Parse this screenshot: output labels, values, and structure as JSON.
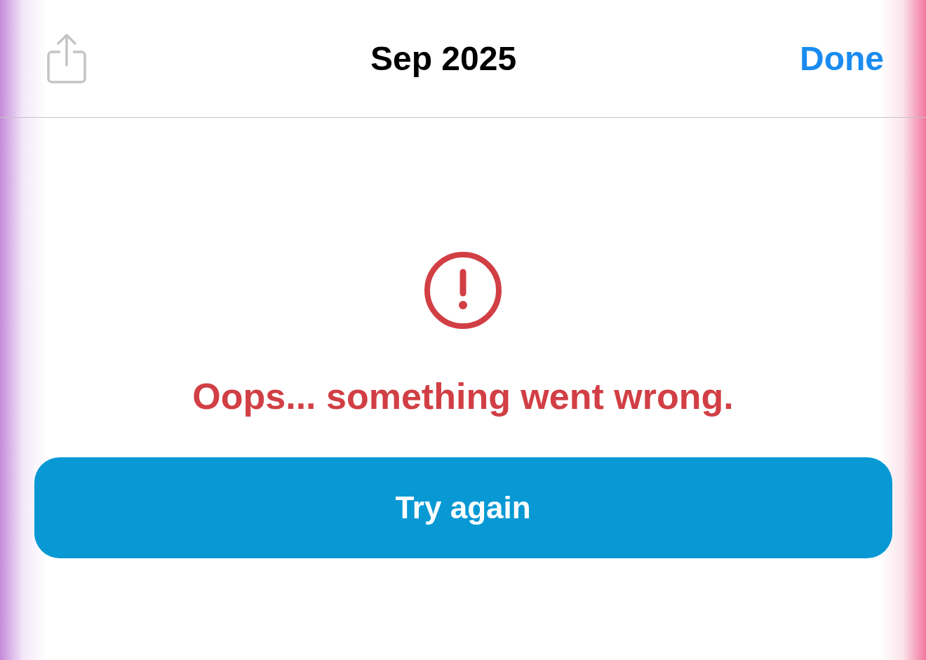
{
  "header": {
    "title": "Sep 2025",
    "share_button": {
      "disabled": true
    },
    "done_button": "Done"
  },
  "error": {
    "message": "Oops... something went wrong.",
    "button": "Try again"
  }
}
